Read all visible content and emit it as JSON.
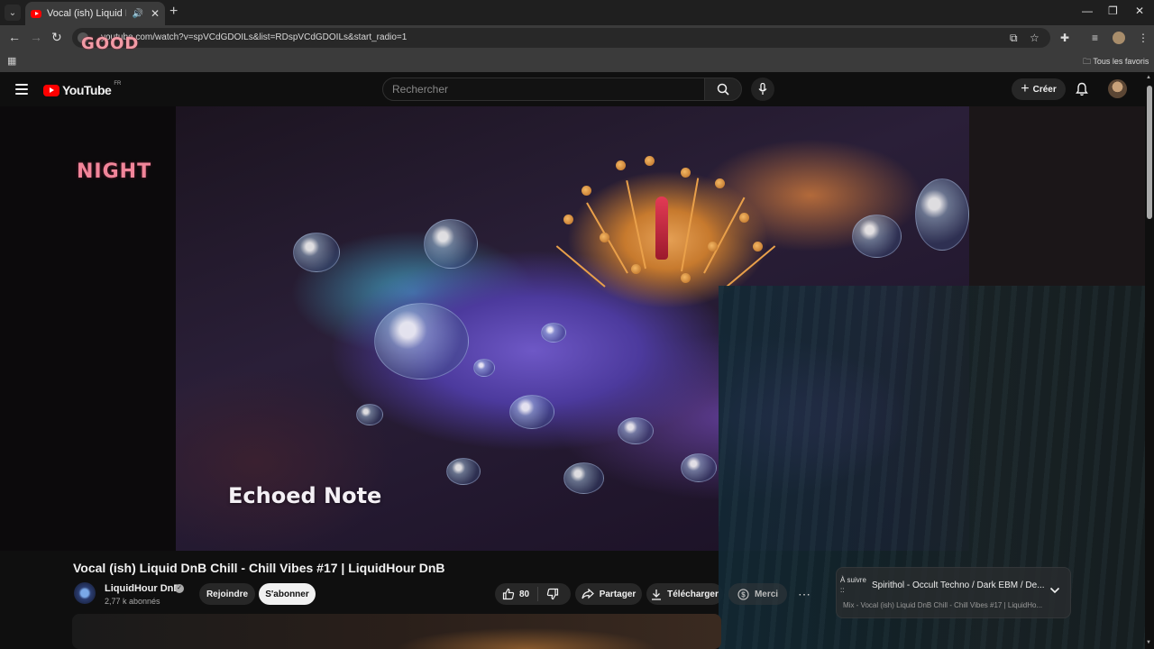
{
  "browser": {
    "tab_title": "Vocal (ish) Liquid DnB Chill",
    "url": "youtube.com/watch?v=spVCdGDOILs&list=RDspVCdGDOILs&start_radio=1",
    "bookmarks_folder": "Tous les favoris"
  },
  "overlays": {
    "top": "GOOD",
    "left": "NIGHT"
  },
  "youtube": {
    "logo_text": "YouTube",
    "region": "FR",
    "search_placeholder": "Rechercher",
    "create_label": "Créer"
  },
  "video": {
    "overlay_text": "Echoed Note",
    "title": "Vocal (ish) Liquid DnB Chill - Chill Vibes #17 | LiquidHour DnB"
  },
  "channel": {
    "name": "LiquidHour DnB",
    "subscribers": "2,77 k abonnés",
    "join_label": "Rejoindre",
    "subscribe_label": "S'abonner"
  },
  "actions": {
    "likes": "80",
    "share_label": "Partager",
    "download_label": "Télécharger",
    "thanks_label": "Merci"
  },
  "up_next": {
    "label": "À suivre ::",
    "title": "Spirithol - Occult Techno / Dark EBM / De...",
    "subtitle": "Mix - Vocal (ish) Liquid DnB Chill - Chill Vibes #17 | LiquidHo..."
  },
  "colors": {
    "youtube_red": "#ff0000",
    "background": "#0f0f0f",
    "overlay_pink": "#f2859a"
  }
}
